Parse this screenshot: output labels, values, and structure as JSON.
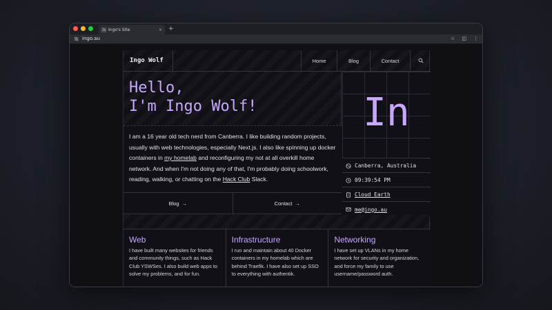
{
  "browser": {
    "tab_title": "Ingo's Site",
    "favicon_text": "IW",
    "url": "ingo.au",
    "new_tab_label": "+",
    "tab_close_label": "×"
  },
  "nav": {
    "brand": "Ingo Wolf",
    "items": [
      {
        "label": "Home"
      },
      {
        "label": "Blog"
      },
      {
        "label": "Contact"
      }
    ]
  },
  "hero": {
    "greeting_line1": "Hello,",
    "greeting_line2": "I'm Ingo Wolf!",
    "bio_part1": "I am a 16 year old tech nerd from Canberra. I like building random projects, usually with web technologies, especially Next.js. I also like spinning up docker containers in ",
    "bio_link1": "my homelab",
    "bio_part2": " and reconfiguring my not at all overkill home network. And when I'm not doing any of that, I'm probably doing schoolwork, reading, walking, or chatting on the ",
    "bio_link2": "Hack Club",
    "bio_part3": " Slack.",
    "buttons": [
      {
        "label": "Blog",
        "arrow": "→"
      },
      {
        "label": "Contact",
        "arrow": "→"
      }
    ],
    "monogram": "In"
  },
  "info": {
    "location": "Canberra, Australia",
    "time": "09:39:54 PM",
    "company": "Cloud Earth",
    "email": "me@ingo.au"
  },
  "cards": [
    {
      "title": "Web",
      "body": "I have built many websites for friends and community things, such as Hack Club YSWSes. I also build web apps to solve my problems, and for fun."
    },
    {
      "title": "Infrastructure",
      "body": "I run and maintain about 40 Docker containers in my homelab which are behind Traefik. I have also set up SSO to everything with authentik."
    },
    {
      "title": "Networking",
      "body": "I have set up VLANs in my home network for security and organization, and force my family to use username/password auth."
    }
  ],
  "colors": {
    "accent": "#c9a6ff",
    "background": "#101016",
    "border": "#34343e"
  }
}
